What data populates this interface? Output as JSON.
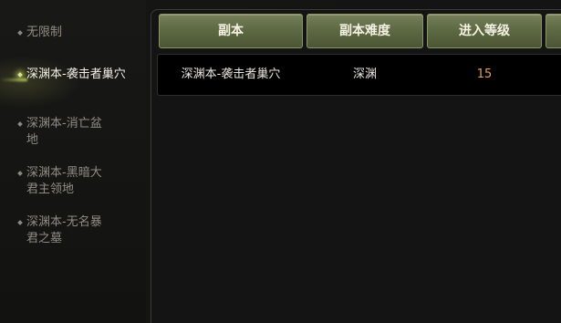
{
  "sidebar": {
    "items": [
      {
        "label": "无限制"
      },
      {
        "label": "深渊本-袭击者巢穴"
      },
      {
        "label": "深渊本-消亡盆地"
      },
      {
        "label": "深渊本-黑暗大君主领地"
      },
      {
        "label": "深渊本-无名暴君之墓"
      }
    ],
    "selected_index": 1
  },
  "table": {
    "headers": [
      "副本",
      "副本难度",
      "进入等级"
    ],
    "rows": [
      {
        "dungeon": "深渊本-袭击者巢穴",
        "difficulty": "深渊",
        "level": "15"
      }
    ]
  },
  "colors": {
    "header_green": "#5e6a44",
    "level_orange": "#e0a05a",
    "selected_glow": "#d9e09a"
  }
}
